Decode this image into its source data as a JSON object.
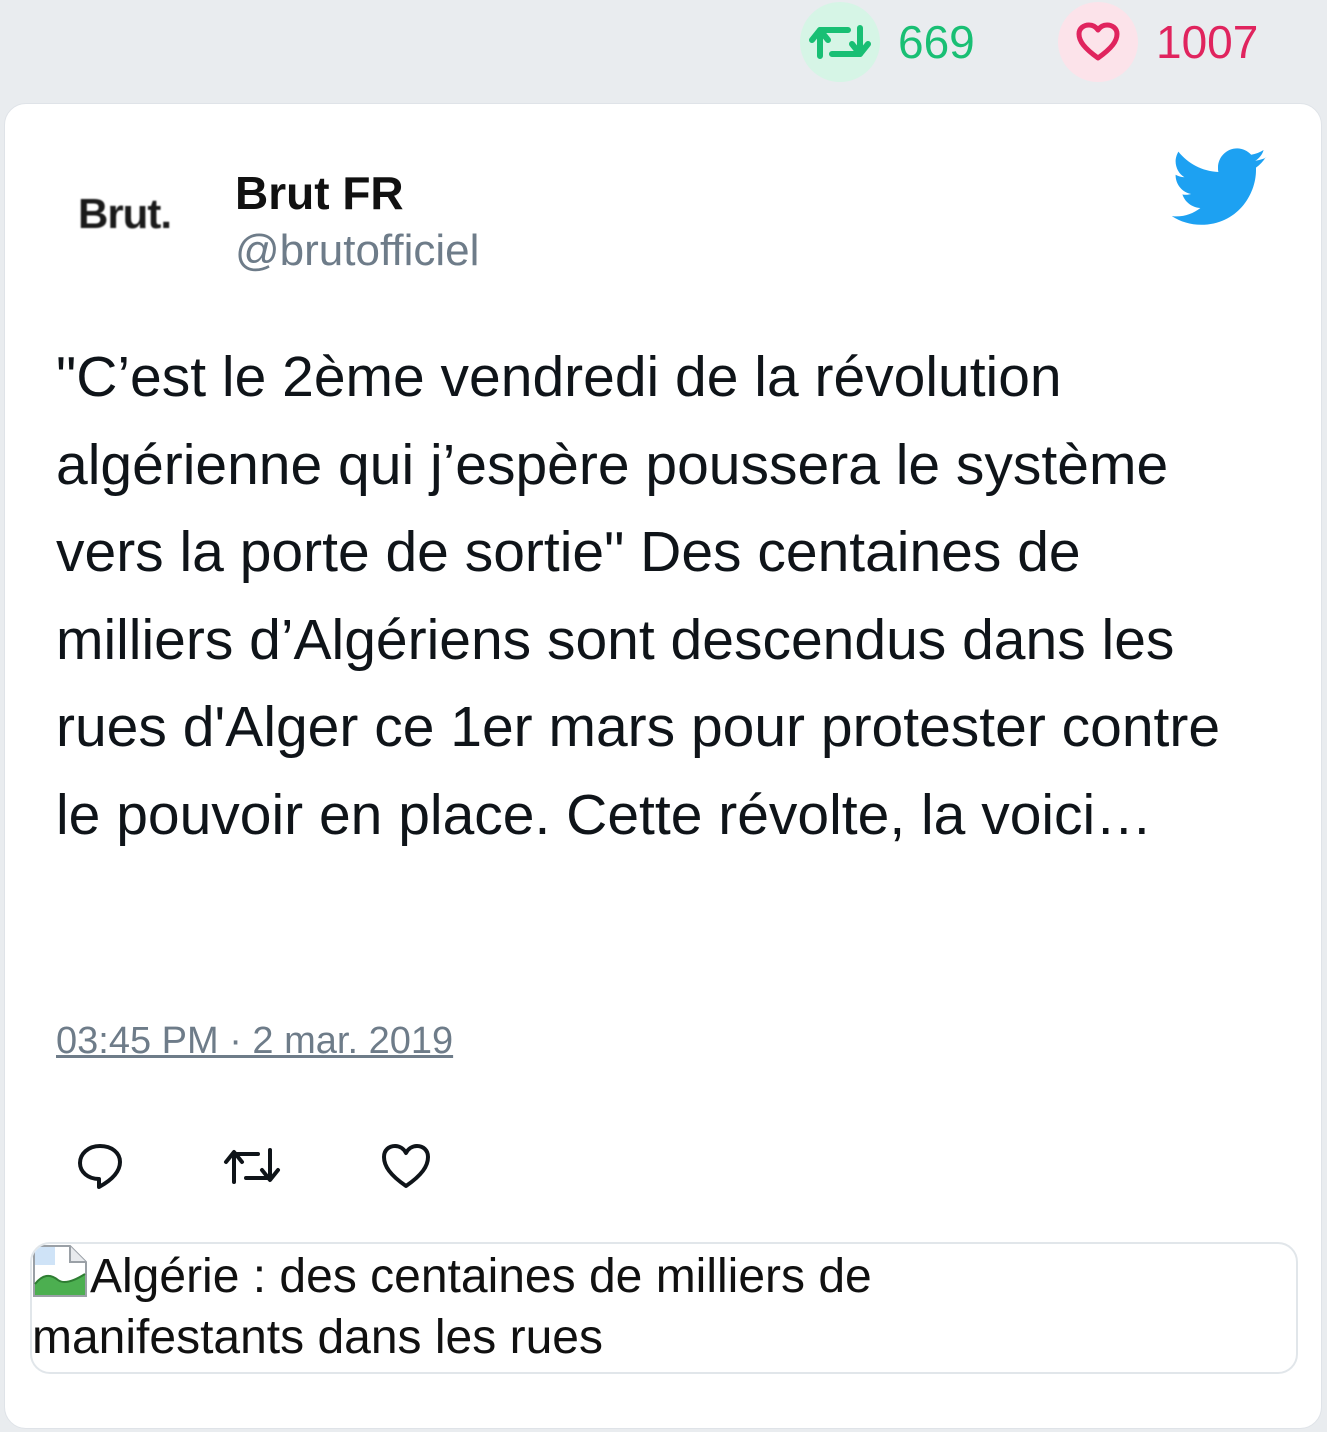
{
  "stats": {
    "retweets": "669",
    "likes": "1007"
  },
  "colors": {
    "retweet_green": "#19bf74",
    "like_red": "#e0245e",
    "twitter_blue": "#1da1f2"
  },
  "author": {
    "logo_text": "Brut.",
    "name": "Brut FR",
    "handle": "@brutofficiel"
  },
  "tweet": {
    "text": "\"C’est le 2ème vendredi de la révolution algérienne qui j’espère poussera le système vers la porte de sortie\" Des centaines de milliers d’Algériens sont descendus dans les rues d'Alger ce 1er mars pour protester contre le pouvoir en place. Cette révolte, la voici…",
    "timestamp": "03:45 PM · 2 mar. 2019"
  },
  "actions": {
    "reply_icon": "reply-icon",
    "retweet_icon": "retweet-icon",
    "like_icon": "heart-icon"
  },
  "link_card": {
    "image_icon": "broken-image-icon",
    "alt_text": "Algérie : des centaines de milliers de manifestants dans les rues"
  }
}
